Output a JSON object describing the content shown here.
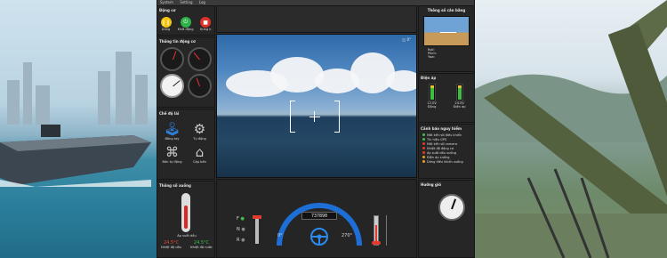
{
  "menu": [
    "System",
    "Setting",
    "Log"
  ],
  "engine": {
    "title": "Động cơ",
    "buttons": [
      "Dừng",
      "Khởi động",
      "Dừng k"
    ]
  },
  "engine_info": {
    "title": "Thông tin động cơ"
  },
  "drive_mode": {
    "title": "Chế độ lái",
    "modes": [
      "Bằng tay",
      "Tự động",
      "Bản tự động",
      "Cập bến"
    ]
  },
  "boat_params": {
    "title": "Thông số xuồng",
    "thermo_label": "Áp suất dầu",
    "values": [
      {
        "value": "24.5°C",
        "label": "Nhiệt độ dầu"
      },
      {
        "value": "24.5°C",
        "label": "Nhiệt độ nước"
      }
    ]
  },
  "balance": {
    "title": "Thông số cân bằng",
    "labels": [
      "Roll:",
      "Pitch:",
      "Yaw:"
    ]
  },
  "voltage": {
    "title": "Điện áp",
    "items": [
      {
        "value": "12.0V",
        "label": "Động"
      },
      {
        "value": "24.0V",
        "label": "Điện áp"
      }
    ]
  },
  "warnings": {
    "title": "Cảnh báo nguy hiểm",
    "items": [
      "Mất kết nối điều khiển",
      "Tín hiệu GPS",
      "Mất kết nối camera",
      "Nhiệt độ động cơ",
      "Áp suất dầu xuồng",
      "Điện áp xuống",
      "Dừng điều khiển xuồng"
    ]
  },
  "wind": {
    "title": "Hướng gió"
  },
  "drive": {
    "gears": [
      "F",
      "N",
      "R"
    ],
    "odometer": "737890",
    "arc_min": "0°",
    "arc_max": "270°"
  },
  "colors": {
    "accent": "#1d6fd6",
    "ok": "#3fc04a",
    "danger": "#e23a2e",
    "warning": "#e7a21f"
  }
}
